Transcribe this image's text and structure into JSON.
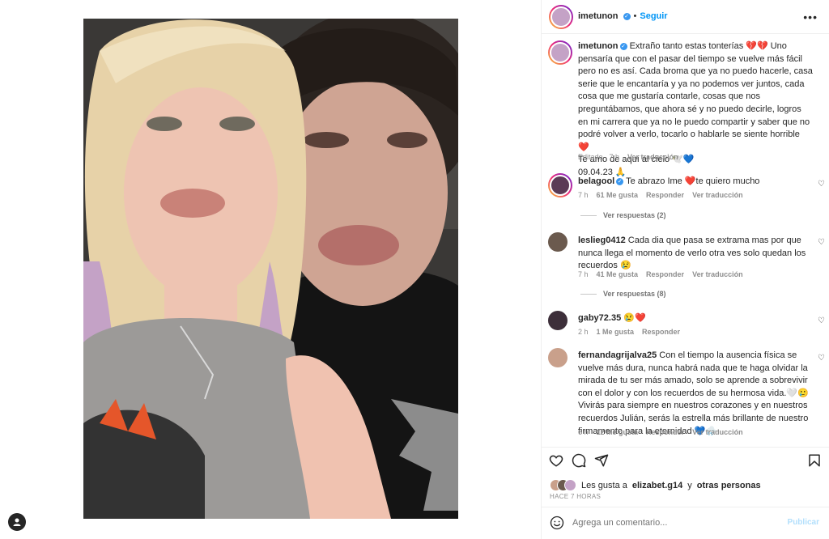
{
  "post": {
    "author": "imetunon",
    "follow_label": "Seguir",
    "more_label": "•••",
    "caption_text": "Extraño tanto estas tonterías 💔💔 Uno pensaría que con el pasar del tiempo se vuelve más fácil pero no es así. Cada broma que ya no puedo hacerle, casa serie que le encantaría y ya no podemos ver juntos, cada cosa que me gustaría contarle, cosas que nos preguntábamos, que ahora sé y no puedo decirle, logros en mi carrera que ya no le puedo compartir y saber que no podré volver a verlo, tocarlo o hablarle se siente horrible ❤️",
    "caption_line2": "Te amo de aquí al cielo 🕊️💙",
    "caption_line3": "09.04.23 🙏",
    "caption_meta": "Editado · 7 h",
    "see_translation": "Ver traducción"
  },
  "comments": [
    {
      "user": "belagool",
      "text": "Te abrazo Ime ❤️te quiero mucho",
      "time": "7 h",
      "likes": "61 Me gusta",
      "reply": "Responder",
      "translate": "Ver traducción",
      "replies": "Ver respuestas (2)"
    },
    {
      "user": "leslieg0412",
      "text": "Cada dia que pasa se extrama mas por que nunca llega el momento de verlo otra ves solo quedan los recuerdos 😢",
      "time": "7 h",
      "likes": "41 Me gusta",
      "reply": "Responder",
      "translate": "Ver traducción",
      "replies": "Ver respuestas (8)"
    },
    {
      "user": "gaby72.35",
      "text": "😢❤️",
      "time": "2 h",
      "likes": "1 Me gusta",
      "reply": "Responder"
    },
    {
      "user": "fernandagrijalva25",
      "text": "Con el tiempo la ausencia física se vuelve más dura, nunca habrá nada que te haga olvidar la mirada de tu ser más amado, solo se aprende a sobrevivir con el dolor y con los recuerdos de su hermosa vida.🤍🥲 Vivirás para siempre en nuestros corazones y en nuestros recuerdos Julián, serás la estrella más brillante de nuestro firmamento para la eternidad 💙🌧️",
      "time": "6 h",
      "likes": "12 Me gusta",
      "reply": "Responder",
      "translate": "Ver traducción"
    }
  ],
  "likes": {
    "prefix": "Les gusta a",
    "user": "elizabet.g14",
    "mid": "y",
    "others": "otras personas"
  },
  "time_ago": "HACE 7 HORAS",
  "comment_box": {
    "placeholder": "Agrega un comentario...",
    "post_label": "Publicar"
  },
  "icons": [
    "heart-icon",
    "comment-icon",
    "share-icon",
    "bookmark-icon",
    "emoji-icon",
    "more-icon",
    "verified-icon",
    "profile-icon"
  ],
  "colors": {
    "link_blue": "#0095f6",
    "verified_blue": "#3897f0",
    "muted": "#8e8e8e",
    "publish_disabled": "#b2dffc"
  }
}
